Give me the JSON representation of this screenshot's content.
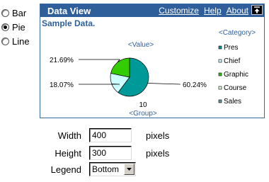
{
  "chart_type_options": [
    {
      "label": "Bar",
      "selected": false
    },
    {
      "label": "Pie",
      "selected": true
    },
    {
      "label": "Line",
      "selected": false
    }
  ],
  "panel": {
    "title": "Data View",
    "links": [
      "Customize",
      "Help",
      "About"
    ],
    "subtitle": "Sample Data."
  },
  "chart_data": {
    "type": "pie",
    "value_label": "<Value>",
    "category_label": "<Category>",
    "group_label": "<Group>",
    "group_value": "10",
    "slices": [
      {
        "name": "Pres",
        "value": 60.24,
        "label": "60.24%",
        "color": "#009999"
      },
      {
        "name": "Chief",
        "value": 18.07,
        "label": "18.07%",
        "color": "#ccffff"
      },
      {
        "name": "Graphic",
        "value": 21.69,
        "label": "21.69%",
        "color": "#33cc00"
      }
    ],
    "legend": [
      "Pres",
      "Chief",
      "Graphic",
      "Course",
      "Sales"
    ],
    "legend_colors": [
      "#009999",
      "#ccffff",
      "#33cc00",
      "#e0ffe0",
      "#669999"
    ]
  },
  "form": {
    "width_label": "Width",
    "width_value": "400",
    "height_label": "Height",
    "height_value": "300",
    "unit": "pixels",
    "legend_label": "Legend",
    "legend_value": "Bottom"
  },
  "colors": {
    "header_bg": "#2f5f9b",
    "accent_text": "#2f5f9b"
  }
}
